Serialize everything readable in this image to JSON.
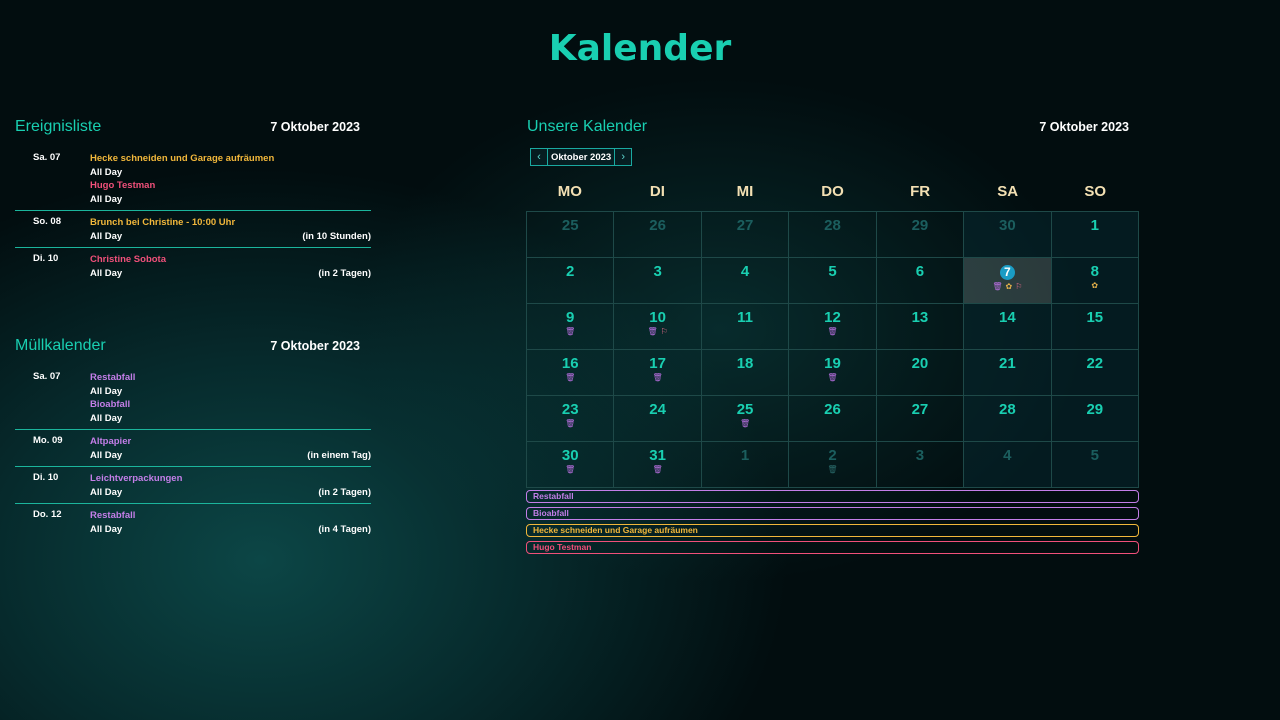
{
  "title": "Kalender",
  "events_panel": {
    "title": "Ereignisliste",
    "date": "7 Oktober 2023",
    "groups": [
      {
        "day": "Sa. 07",
        "entries": [
          {
            "name": "Hecke schneiden und Garage aufräumen",
            "color": "orange",
            "sub": "All Day",
            "rel": ""
          },
          {
            "name": "Hugo Testman",
            "color": "pink",
            "sub": "All Day",
            "rel": ""
          }
        ]
      },
      {
        "day": "So. 08",
        "entries": [
          {
            "name": "Brunch bei Christine - 10:00 Uhr",
            "color": "orange",
            "sub": "All Day",
            "rel": "(in 10 Stunden)"
          }
        ]
      },
      {
        "day": "Di. 10",
        "entries": [
          {
            "name": "Christine Sobota",
            "color": "pink",
            "sub": "All Day",
            "rel": "(in 2 Tagen)"
          }
        ]
      }
    ]
  },
  "waste_panel": {
    "title": "Müllkalender",
    "date": "7 Oktober 2023",
    "groups": [
      {
        "day": "Sa. 07",
        "entries": [
          {
            "name": "Restabfall",
            "color": "purple",
            "sub": "All Day",
            "rel": ""
          },
          {
            "name": "Bioabfall",
            "color": "purple",
            "sub": "All Day",
            "rel": ""
          }
        ]
      },
      {
        "day": "Mo. 09",
        "entries": [
          {
            "name": "Altpapier",
            "color": "purple",
            "sub": "All Day",
            "rel": "(in einem Tag)"
          }
        ]
      },
      {
        "day": "Di. 10",
        "entries": [
          {
            "name": "Leichtverpackungen",
            "color": "purple",
            "sub": "All Day",
            "rel": "(in 2 Tagen)"
          }
        ]
      },
      {
        "day": "Do. 12",
        "entries": [
          {
            "name": "Restabfall",
            "color": "purple",
            "sub": "All Day",
            "rel": "(in 4 Tagen)"
          }
        ]
      }
    ]
  },
  "calendar": {
    "title": "Unsere Kalender",
    "date": "7 Oktober 2023",
    "month_label": "Oktober 2023",
    "prev_icon": "‹",
    "next_icon": "›",
    "weekdays": [
      "MO",
      "DI",
      "MI",
      "DO",
      "FR",
      "SA",
      "SO"
    ],
    "cells": [
      {
        "d": "25",
        "other": true
      },
      {
        "d": "26",
        "other": true
      },
      {
        "d": "27",
        "other": true
      },
      {
        "d": "28",
        "other": true
      },
      {
        "d": "29",
        "other": true
      },
      {
        "d": "30",
        "other": true
      },
      {
        "d": "1"
      },
      {
        "d": "2"
      },
      {
        "d": "3"
      },
      {
        "d": "4"
      },
      {
        "d": "5"
      },
      {
        "d": "6"
      },
      {
        "d": "7",
        "today": true,
        "marks": [
          "bin",
          "flower",
          "user"
        ]
      },
      {
        "d": "8",
        "marks": [
          "flower"
        ]
      },
      {
        "d": "9",
        "marks": [
          "bin"
        ]
      },
      {
        "d": "10",
        "marks": [
          "bin",
          "user"
        ]
      },
      {
        "d": "11"
      },
      {
        "d": "12",
        "marks": [
          "bin"
        ]
      },
      {
        "d": "13"
      },
      {
        "d": "14"
      },
      {
        "d": "15"
      },
      {
        "d": "16",
        "marks": [
          "bin"
        ]
      },
      {
        "d": "17",
        "marks": [
          "bin"
        ]
      },
      {
        "d": "18"
      },
      {
        "d": "19",
        "marks": [
          "bin"
        ]
      },
      {
        "d": "20"
      },
      {
        "d": "21"
      },
      {
        "d": "22"
      },
      {
        "d": "23",
        "marks": [
          "bin"
        ]
      },
      {
        "d": "24"
      },
      {
        "d": "25",
        "marks": [
          "bin"
        ]
      },
      {
        "d": "26"
      },
      {
        "d": "27"
      },
      {
        "d": "28"
      },
      {
        "d": "29"
      },
      {
        "d": "30",
        "marks": [
          "bin"
        ]
      },
      {
        "d": "31",
        "marks": [
          "bin"
        ]
      },
      {
        "d": "1",
        "other": true
      },
      {
        "d": "2",
        "other": true,
        "marks": [
          "bin"
        ]
      },
      {
        "d": "3",
        "other": true
      },
      {
        "d": "4",
        "other": true
      },
      {
        "d": "5",
        "other": true
      }
    ],
    "legend": [
      {
        "label": "Restabfall",
        "color": "purple"
      },
      {
        "label": "Bioabfall",
        "color": "purple"
      },
      {
        "label": "Hecke schneiden und Garage aufräumen",
        "color": "orange"
      },
      {
        "label": "Hugo Testman",
        "color": "pink"
      }
    ]
  },
  "colors": {
    "accent": "#19cfb1",
    "orange": "#f1b73b",
    "pink": "#f0507a",
    "purple": "#c37ee8",
    "today": "#1a9cc5"
  }
}
